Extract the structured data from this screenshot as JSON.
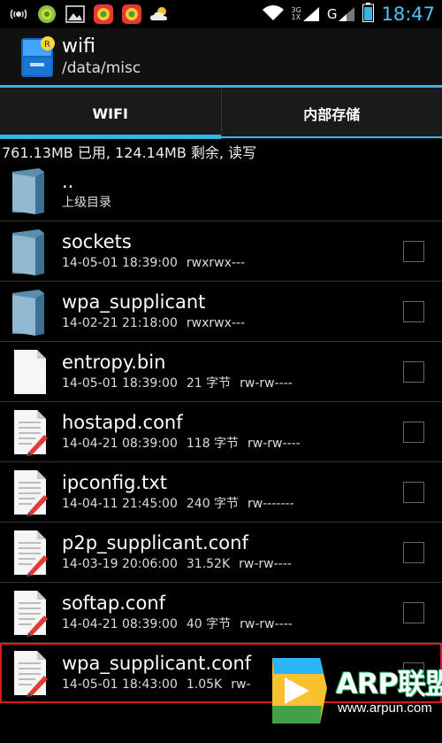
{
  "status": {
    "time": "18:47",
    "net_top": "3G",
    "net_bottom": "1X",
    "net_g": "G",
    "icons": [
      "usb-debug-icon",
      "android-icon",
      "image-icon",
      "app-store-icon",
      "app-store-icon",
      "weather-icon"
    ]
  },
  "actionbar": {
    "title": "wifi",
    "subtitle": "/data/misc"
  },
  "tabs": [
    {
      "label": "WIFI",
      "active": true
    },
    {
      "label": "内部存储",
      "active": false
    }
  ],
  "storage": "761.13MB 已用, 124.14MB 剩余, 读写",
  "files": [
    {
      "name": "..",
      "date": "",
      "size": "",
      "perms": "",
      "meta": "上级目录",
      "type": "parent"
    },
    {
      "name": "sockets",
      "date": "14-05-01 18:39:00",
      "size": "",
      "perms": "rwxrwx---",
      "type": "folder"
    },
    {
      "name": "wpa_supplicant",
      "date": "14-02-21 21:18:00",
      "size": "",
      "perms": "rwxrwx---",
      "type": "folder"
    },
    {
      "name": "entropy.bin",
      "date": "14-05-01 18:39:00",
      "size": "21 字节",
      "perms": "rw-rw----",
      "type": "blank"
    },
    {
      "name": "hostapd.conf",
      "date": "14-04-21 08:39:00",
      "size": "118 字节",
      "perms": "rw-rw----",
      "type": "text"
    },
    {
      "name": "ipconfig.txt",
      "date": "14-04-11 21:45:00",
      "size": "240 字节",
      "perms": "rw-------",
      "type": "text"
    },
    {
      "name": "p2p_supplicant.conf",
      "date": "14-03-19 20:06:00",
      "size": "31.52K",
      "perms": "rw-rw----",
      "type": "text"
    },
    {
      "name": "softap.conf",
      "date": "14-04-21 08:39:00",
      "size": "40 字节",
      "perms": "rw-rw----",
      "type": "text"
    },
    {
      "name": "wpa_supplicant.conf",
      "date": "14-05-01 18:43:00",
      "size": "1.05K",
      "perms": "rw-",
      "type": "text",
      "selected": true
    }
  ],
  "watermark": {
    "brand": "ARP联盟",
    "url": "www.arpun.com"
  },
  "colors": {
    "accent": "#33b5e5",
    "highlight": "#d71920",
    "clock": "#4fc3f7"
  }
}
